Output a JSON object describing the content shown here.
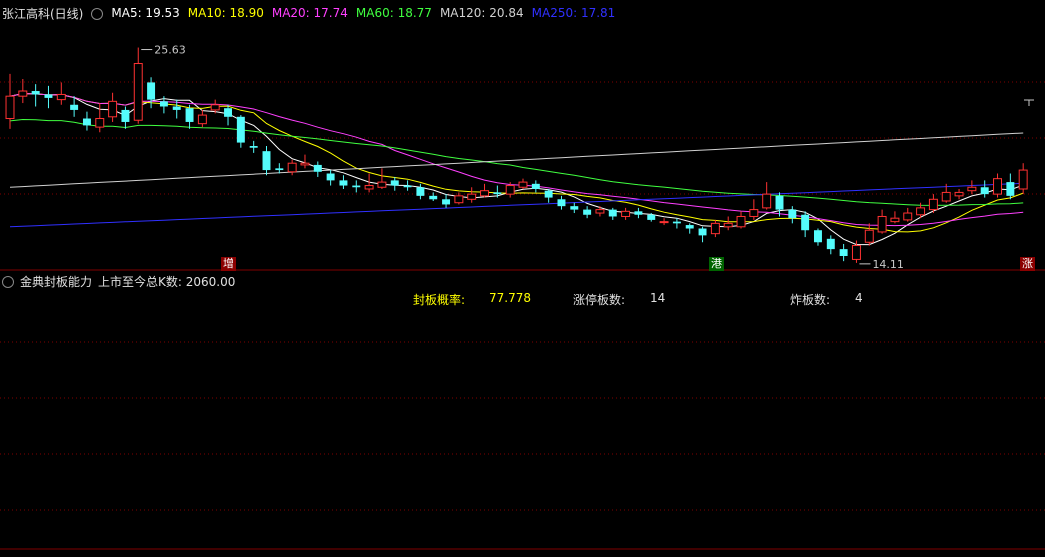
{
  "header": {
    "stock_title": "张江高科(日线)",
    "ma": [
      {
        "label": "MA5: 19.53",
        "color": "#ffffff"
      },
      {
        "label": "MA10: 18.90",
        "color": "#ffff00"
      },
      {
        "label": "MA20: 17.74",
        "color": "#ff40ff"
      },
      {
        "label": "MA60: 18.77",
        "color": "#40ff40"
      },
      {
        "label": "MA120: 20.84",
        "color": "#d0d0d0"
      },
      {
        "label": "MA250: 17.81",
        "color": "#3030ff"
      }
    ]
  },
  "annotations": {
    "high_label": "25.63",
    "low_label": "14.11"
  },
  "tags": [
    {
      "text": "增",
      "bg": "#8b0000"
    },
    {
      "text": "港",
      "bg": "#006400"
    },
    {
      "text": "涨",
      "bg": "#8b0000"
    }
  ],
  "indicator": {
    "title": "金典封板能力",
    "subtitle": "上市至今总K数: 2060.00",
    "seal_rate_label": "封板概率:",
    "seal_rate_value": "77.778",
    "limit_up_label": "涨停板数:",
    "limit_up_value": "14",
    "broken_label": "炸板数:",
    "broken_value": "4"
  },
  "colors": {
    "up": "#ff3232",
    "down": "#54fcfc",
    "grid": "#800000",
    "text_yellow": "#ffff00"
  },
  "chart_data": {
    "type": "candlestick",
    "ylim": [
      13.5,
      27
    ],
    "candles": [
      [
        21.5,
        22.8,
        24.1,
        20.9
      ],
      [
        22.8,
        23.1,
        23.8,
        22.4
      ],
      [
        23.1,
        22.9,
        23.5,
        22.2
      ],
      [
        22.9,
        22.7,
        23.4,
        22.1
      ],
      [
        22.6,
        22.9,
        23.6,
        22.3
      ],
      [
        22.3,
        22.0,
        22.8,
        21.6
      ],
      [
        21.5,
        21.1,
        21.9,
        20.8
      ],
      [
        21.0,
        21.5,
        22.4,
        20.7
      ],
      [
        21.6,
        22.5,
        23.0,
        21.3
      ],
      [
        22.0,
        21.3,
        22.2,
        20.9
      ],
      [
        21.4,
        24.7,
        25.63,
        21.2
      ],
      [
        23.6,
        22.6,
        23.9,
        22.1
      ],
      [
        22.5,
        22.2,
        22.8,
        21.8
      ],
      [
        22.2,
        22.0,
        22.6,
        21.5
      ],
      [
        22.1,
        21.3,
        22.3,
        20.9
      ],
      [
        21.2,
        21.7,
        22.0,
        21.0
      ],
      [
        22.0,
        22.3,
        22.6,
        21.8
      ],
      [
        22.1,
        21.6,
        22.3,
        21.1
      ],
      [
        21.6,
        20.1,
        21.7,
        19.8
      ],
      [
        19.9,
        19.8,
        20.2,
        19.5
      ],
      [
        19.6,
        18.5,
        19.9,
        18.2
      ],
      [
        18.6,
        18.5,
        18.9,
        18.3
      ],
      [
        18.4,
        18.9,
        19.1,
        18.2
      ],
      [
        18.8,
        18.9,
        19.4,
        18.6
      ],
      [
        18.8,
        18.4,
        19.0,
        18.1
      ],
      [
        18.3,
        17.9,
        18.5,
        17.6
      ],
      [
        17.9,
        17.6,
        18.2,
        17.4
      ],
      [
        17.6,
        17.5,
        17.9,
        17.2
      ],
      [
        17.4,
        17.6,
        18.3,
        17.2
      ],
      [
        17.5,
        17.8,
        18.6,
        17.4
      ],
      [
        17.9,
        17.6,
        18.1,
        17.3
      ],
      [
        17.6,
        17.5,
        17.9,
        17.3
      ],
      [
        17.5,
        17.0,
        17.7,
        16.8
      ],
      [
        17.0,
        16.8,
        17.2,
        16.7
      ],
      [
        16.8,
        16.5,
        17.1,
        16.3
      ],
      [
        16.6,
        17.0,
        17.2,
        16.5
      ],
      [
        16.8,
        17.1,
        17.5,
        16.6
      ],
      [
        17.0,
        17.3,
        17.7,
        16.9
      ],
      [
        17.2,
        17.1,
        17.6,
        16.9
      ],
      [
        17.1,
        17.6,
        17.8,
        16.9
      ],
      [
        17.5,
        17.8,
        18.0,
        17.4
      ],
      [
        17.7,
        17.4,
        17.9,
        17.2
      ],
      [
        17.3,
        16.9,
        17.4,
        16.6
      ],
      [
        16.8,
        16.4,
        17.0,
        16.2
      ],
      [
        16.4,
        16.2,
        16.6,
        16.0
      ],
      [
        16.2,
        15.9,
        16.4,
        15.7
      ],
      [
        16.0,
        16.2,
        16.4,
        15.8
      ],
      [
        16.2,
        15.8,
        16.3,
        15.6
      ],
      [
        15.8,
        16.1,
        16.3,
        15.6
      ],
      [
        16.1,
        15.9,
        16.3,
        15.7
      ],
      [
        15.9,
        15.6,
        16.0,
        15.5
      ],
      [
        15.5,
        15.5,
        15.7,
        15.3
      ],
      [
        15.5,
        15.4,
        15.7,
        15.1
      ],
      [
        15.3,
        15.1,
        15.4,
        14.8
      ],
      [
        15.1,
        14.7,
        15.2,
        14.3
      ],
      [
        14.8,
        15.4,
        15.6,
        14.6
      ],
      [
        15.2,
        15.4,
        15.8,
        15.0
      ],
      [
        15.2,
        15.8,
        16.1,
        15.1
      ],
      [
        15.8,
        16.2,
        16.8,
        15.6
      ],
      [
        16.3,
        17.1,
        17.8,
        16.2
      ],
      [
        17.0,
        16.2,
        17.2,
        15.8
      ],
      [
        16.2,
        15.7,
        16.4,
        15.4
      ],
      [
        15.9,
        15.0,
        16.1,
        14.6
      ],
      [
        15.0,
        14.3,
        15.1,
        14.1
      ],
      [
        14.5,
        13.9,
        14.7,
        13.6
      ],
      [
        13.9,
        13.5,
        14.2,
        13.2
      ],
      [
        13.3,
        14.11,
        14.4,
        13.1
      ],
      [
        14.3,
        15.0,
        15.4,
        14.1
      ],
      [
        14.9,
        15.8,
        16.2,
        14.8
      ],
      [
        15.5,
        15.7,
        16.1,
        15.4
      ],
      [
        15.6,
        16.0,
        16.3,
        15.5
      ],
      [
        15.9,
        16.3,
        16.6,
        15.7
      ],
      [
        16.2,
        16.8,
        17.1,
        16.0
      ],
      [
        16.7,
        17.2,
        17.7,
        16.6
      ],
      [
        17.0,
        17.2,
        17.4,
        16.8
      ],
      [
        17.3,
        17.5,
        17.9,
        17.1
      ],
      [
        17.5,
        17.1,
        17.9,
        16.9
      ],
      [
        17.1,
        18.0,
        18.3,
        16.9
      ],
      [
        17.8,
        17.0,
        18.3,
        16.8
      ],
      [
        17.4,
        18.5,
        18.9,
        17.1
      ]
    ]
  }
}
